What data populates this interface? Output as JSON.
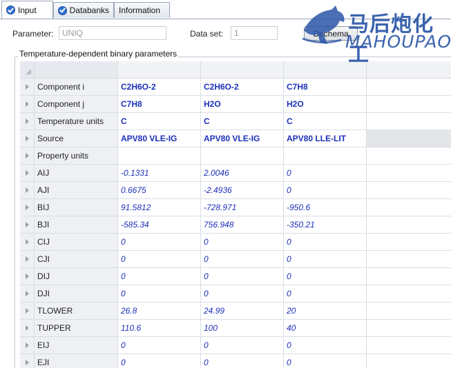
{
  "tabs": [
    {
      "label": "Input",
      "icon": "check-circle-icon",
      "active": true
    },
    {
      "label": "Databanks",
      "icon": "check-circle-icon",
      "active": false
    },
    {
      "label": "Information",
      "icon": "",
      "active": false
    }
  ],
  "watermark": {
    "cn": "马后炮化工",
    "en": "MAHOUPAO"
  },
  "form": {
    "parameter_label": "Parameter:",
    "parameter_value": "UNIQ",
    "dataset_label": "Data set:",
    "dataset_value": "1",
    "dechema_label": "Dechema"
  },
  "group_title": "Temperature-dependent binary parameters",
  "grid": {
    "rows": [
      {
        "name": "Component  i",
        "values": [
          "C2H6O-2",
          "C2H6O-2",
          "C7H8"
        ],
        "style": "bold"
      },
      {
        "name": "Component  j",
        "values": [
          "C7H8",
          "H2O",
          "H2O"
        ],
        "style": "bold"
      },
      {
        "name": "Temperature units",
        "values": [
          "C",
          "C",
          "C"
        ],
        "style": "bold"
      },
      {
        "name": "Source",
        "values": [
          "APV80 VLE-IG",
          "APV80 VLE-IG",
          "APV80 LLE-LIT"
        ],
        "style": "bold"
      },
      {
        "name": "Property units",
        "values": [
          "",
          "",
          ""
        ],
        "style": "bold"
      },
      {
        "name": "AIJ",
        "values": [
          "-0.1331",
          "2.0046",
          "0"
        ],
        "style": "num"
      },
      {
        "name": "AJI",
        "values": [
          "0.6675",
          "-2.4936",
          "0"
        ],
        "style": "num"
      },
      {
        "name": "BIJ",
        "values": [
          "91.5812",
          "-728.971",
          "-950.6"
        ],
        "style": "num"
      },
      {
        "name": "BJI",
        "values": [
          "-585.34",
          "756.948",
          "-350.21"
        ],
        "style": "num"
      },
      {
        "name": "CIJ",
        "values": [
          "0",
          "0",
          "0"
        ],
        "style": "num"
      },
      {
        "name": "CJI",
        "values": [
          "0",
          "0",
          "0"
        ],
        "style": "num"
      },
      {
        "name": "DIJ",
        "values": [
          "0",
          "0",
          "0"
        ],
        "style": "num"
      },
      {
        "name": "DJI",
        "values": [
          "0",
          "0",
          "0"
        ],
        "style": "num"
      },
      {
        "name": "TLOWER",
        "values": [
          "26.8",
          "24.99",
          "20"
        ],
        "style": "num"
      },
      {
        "name": "TUPPER",
        "values": [
          "110.6",
          "100",
          "40"
        ],
        "style": "num"
      },
      {
        "name": "EIJ",
        "values": [
          "0",
          "0",
          "0"
        ],
        "style": "num"
      },
      {
        "name": "EJI",
        "values": [
          "0",
          "0",
          "0"
        ],
        "style": "num"
      }
    ]
  },
  "colors": {
    "value_text": "#1c2fb8",
    "accent": "#2f6fd0",
    "watermark": "#2b56a8"
  }
}
